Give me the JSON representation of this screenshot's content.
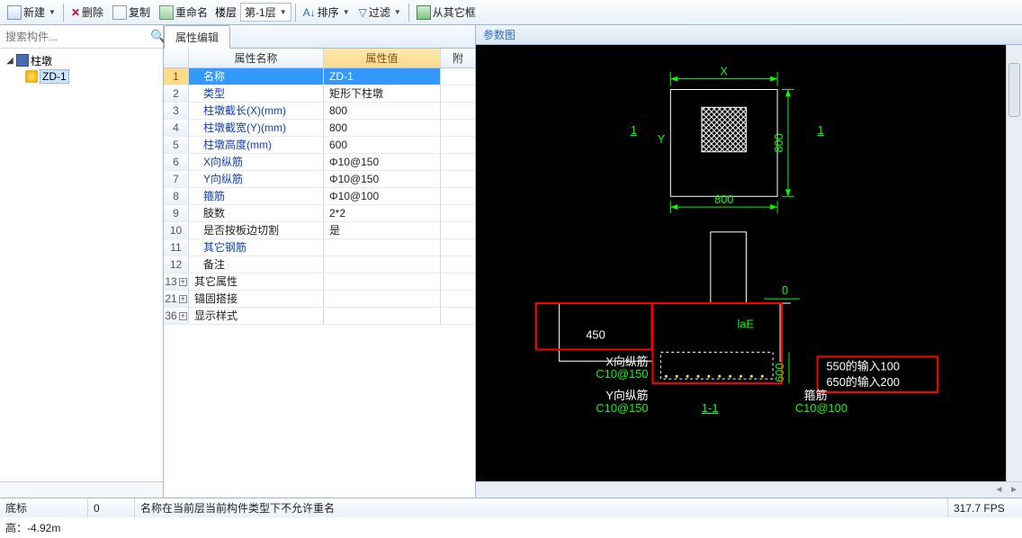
{
  "toolbar": {
    "new": "新建",
    "delete": "删除",
    "copy": "复制",
    "rename": "重命名",
    "floor_lbl": "楼层",
    "floor_val": "第-1层",
    "sort": "排序",
    "filter": "过滤",
    "from_other": "从其它框"
  },
  "search": {
    "placeholder": "搜索构件..."
  },
  "tree": {
    "root": "柱墩",
    "child": "ZD-1"
  },
  "prop_tab": "属性编辑",
  "grid_head": {
    "name": "属性名称",
    "value": "属性值",
    "extra": "附"
  },
  "rows": [
    {
      "n": "1",
      "name": "名称",
      "val": "ZD-1",
      "blue": true,
      "sel": true
    },
    {
      "n": "2",
      "name": "类型",
      "val": "矩形下柱墩",
      "blue": true
    },
    {
      "n": "3",
      "name": "柱墩截长(X)(mm)",
      "val": "800",
      "blue": true
    },
    {
      "n": "4",
      "name": "柱墩截宽(Y)(mm)",
      "val": "800",
      "blue": true
    },
    {
      "n": "5",
      "name": "柱墩高度(mm)",
      "val": "600",
      "blue": true
    },
    {
      "n": "6",
      "name": "X向纵筋",
      "val": "Φ10@150",
      "blue": true
    },
    {
      "n": "7",
      "name": "Y向纵筋",
      "val": "Φ10@150",
      "blue": true
    },
    {
      "n": "8",
      "name": "箍筋",
      "val": "Φ10@100",
      "blue": true
    },
    {
      "n": "9",
      "name": "肢数",
      "val": "2*2"
    },
    {
      "n": "10",
      "name": "是否按板边切割",
      "val": "是"
    },
    {
      "n": "11",
      "name": "其它钢筋",
      "val": "",
      "blue": true
    },
    {
      "n": "12",
      "name": "备注",
      "val": ""
    },
    {
      "n": "13",
      "name": "其它属性",
      "val": "",
      "group": true
    },
    {
      "n": "21",
      "name": "锚固搭接",
      "val": "",
      "group": true
    },
    {
      "n": "36",
      "name": "显示样式",
      "val": "",
      "group": true
    }
  ],
  "rpanel_title": "参数图",
  "cad": {
    "plan": {
      "dimX": "X",
      "dimY": "Y",
      "dim800a": "800",
      "dim800b": "800",
      "sec1a": "1",
      "sec1b": "1"
    },
    "elev": {
      "h450": "450",
      "laE": "laE",
      "zero": "0",
      "d600": "600",
      "xlab": "X向纵筋",
      "xval": "C10@150",
      "ylab": "Y向纵筋",
      "yval": "C10@150",
      "glab": "箍筋",
      "gval": "C10@100",
      "sec11": "1-1",
      "ann1": "550的输入100",
      "ann2": "650的输入200"
    }
  },
  "status": {
    "elev": "底标高：-4.92m",
    "zero": "0",
    "msg": "名称在当前层当前构件类型下不允许重名",
    "fps": "317.7 FPS"
  }
}
